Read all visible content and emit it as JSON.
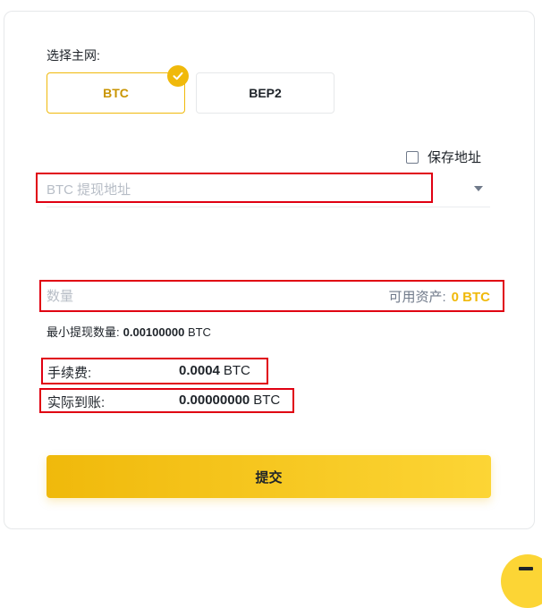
{
  "network": {
    "label": "选择主网:",
    "options": [
      {
        "label": "BTC",
        "selected": true
      },
      {
        "label": "BEP2",
        "selected": false
      }
    ]
  },
  "address": {
    "save_label": "保存地址",
    "save_checked": false,
    "placeholder": "BTC 提现地址"
  },
  "amount": {
    "placeholder": "数量",
    "available_label": "可用资产:",
    "available_value": "0 BTC"
  },
  "minimum": {
    "label": "最小提现数量:",
    "value": "0.00100000",
    "unit": "BTC"
  },
  "fee": {
    "label": "手续费:",
    "value": "0.0004",
    "unit": "BTC"
  },
  "received": {
    "label": "实际到账:",
    "value": "0.00000000",
    "unit": "BTC"
  },
  "submit_label": "提交",
  "colors": {
    "accent": "#f0b90b",
    "highlight_border": "#e00012",
    "placeholder": "#b7bdc6"
  }
}
